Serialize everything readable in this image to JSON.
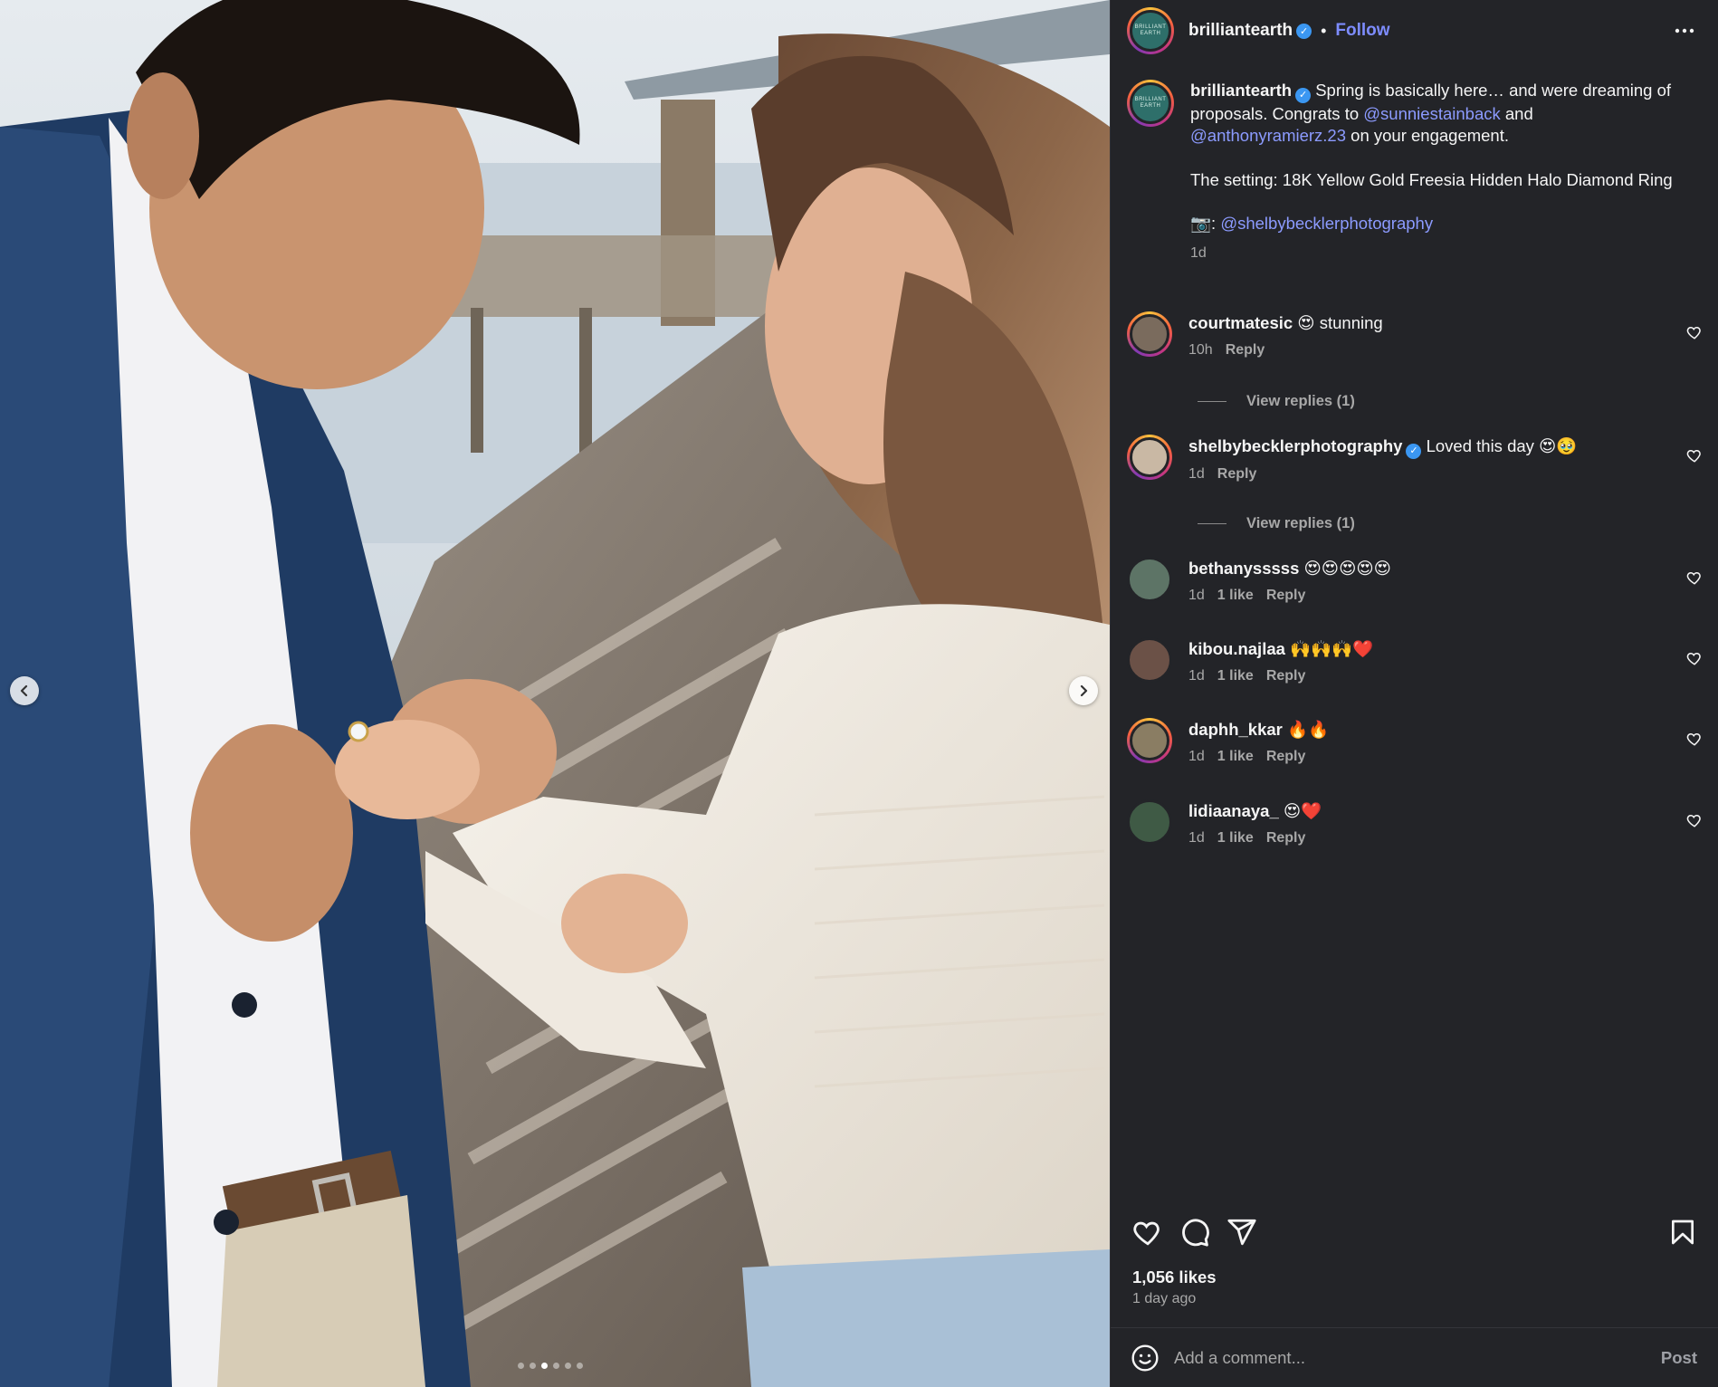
{
  "media": {
    "image_alt": "Man placing engagement ring on woman's finger on a wooden pier",
    "carousel_dots": 6,
    "active_dot": 3
  },
  "header": {
    "username": "brilliantearth",
    "avatar_text": "BRILLIANT EARTH",
    "separator": "•",
    "follow_label": "Follow"
  },
  "caption": {
    "username": "brilliantearth",
    "text_1": " Spring is basically here… and were dreaming of proposals. Congrats to ",
    "mention_1": "@sunniestainback",
    "text_2": " and ",
    "mention_2": "@anthonyramierz.23",
    "text_3": " on your engagement.",
    "setting_line": "The setting: 18K Yellow Gold Freesia Hidden Halo Diamond Ring",
    "camera_emoji": "📷:",
    "mention_3": "@shelbybecklerphotography",
    "time": "1d"
  },
  "comments": [
    {
      "username": "courtmatesic",
      "text": "😍 stunning",
      "time": "10h",
      "likes": "",
      "reply": "Reply"
    },
    {
      "username": "shelbybecklerphotography",
      "text": "Loved this day 😍🥹",
      "time": "1d",
      "likes": "",
      "reply": "Reply"
    },
    {
      "username": "bethanysssss",
      "text": "😍😍😍😍😍",
      "time": "1d",
      "likes": "1 like",
      "reply": "Reply"
    },
    {
      "username": "kibou.najlaa",
      "text": "🙌🙌🙌❤️",
      "time": "1d",
      "likes": "1 like",
      "reply": "Reply"
    },
    {
      "username": "daphh_kkar",
      "text": "🔥🔥",
      "time": "1d",
      "likes": "1 like",
      "reply": "Reply"
    },
    {
      "username": "lidiaanaya_",
      "text": "😍❤️",
      "time": "1d",
      "likes": "1 like",
      "reply": "Reply"
    }
  ],
  "view_replies": [
    "View replies (1)",
    "View replies (1)"
  ],
  "footer": {
    "likes": "1,056 likes",
    "ago": "1 day ago",
    "comment_placeholder": "Add a comment...",
    "post_label": "Post"
  },
  "icons": {
    "like": "heart-icon",
    "comment": "comment-icon",
    "share": "share-icon",
    "save": "bookmark-icon",
    "emoji": "emoji-icon",
    "more": "more-icon"
  },
  "colors": {
    "panel_bg": "#232428",
    "link": "#7d8cff",
    "verified": "#3b97f2"
  }
}
